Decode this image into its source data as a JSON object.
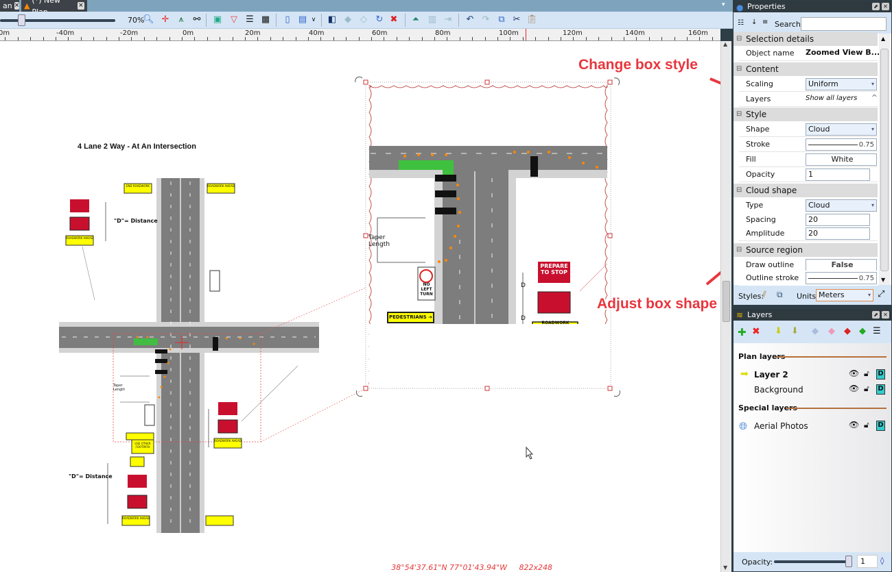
{
  "tabs": [
    {
      "label": "an"
    },
    {
      "label": "(*) New Plan"
    }
  ],
  "toolbar": {
    "zoom": "70%",
    "zoom_fraction": 0.2
  },
  "ruler": {
    "labels": [
      "0m",
      "-40m",
      "-20m",
      "0m",
      "20m",
      "40m",
      "60m",
      "80m",
      "100m",
      "120m",
      "140m",
      "160m"
    ]
  },
  "drawing": {
    "title": "4 Lane 2 Way - At An Intersection",
    "distance_note": "\"D\"= Distance",
    "d": "D",
    "taper": "Taper Length",
    "signs": {
      "end_roadwork": "END ROADWORK",
      "roadwork_ahead": "ROADWORK AHEAD",
      "prepare": "PREPARE TO STOP",
      "no_left": "NO LEFT TURN",
      "pedestrians": "PEDESTRIANS ➔",
      "use_other": "USE OTHER FOOTPATH",
      "roadwork": "ROADWORK"
    }
  },
  "annotations": {
    "change_style": "Change box style",
    "adjust_shape": "Adjust box shape",
    "color": "#e8363d"
  },
  "status": {
    "coords": "38°54'37.61\"N 77°01'43.94\"W",
    "size": "822x248"
  },
  "properties": {
    "title": "Properties",
    "search_label": "Search:",
    "search_value": "",
    "sections": {
      "selection": "Selection details",
      "content": "Content",
      "style": "Style",
      "cloud": "Cloud shape",
      "source": "Source region"
    },
    "object_name_label": "Object name",
    "object_name": "Zoomed View B...",
    "scaling_label": "Scaling",
    "scaling": "Uniform",
    "layers_label": "Layers",
    "layers": "Show all layers",
    "shape_label": "Shape",
    "shape": "Cloud",
    "stroke_label": "Stroke",
    "stroke": "0.75",
    "fill_label": "Fill",
    "fill": "White",
    "opacity_label": "Opacity",
    "opacity": "1",
    "type_label": "Type",
    "type": "Cloud",
    "spacing_label": "Spacing",
    "spacing": "20",
    "amplitude_label": "Amplitude",
    "amplitude": "20",
    "draw_outline_label": "Draw outline",
    "draw_outline": "False",
    "outline_stroke_label": "Outline stroke",
    "outline_stroke": "0.75",
    "styles_label": "Styles:",
    "units_label": "Units:",
    "units": "Meters"
  },
  "layers": {
    "title": "Layers",
    "plan_layers": "Plan layers",
    "special_layers": "Special layers",
    "items": [
      {
        "name": "Layer 2",
        "active": true
      },
      {
        "name": "Background"
      },
      {
        "name": "Aerial Photos"
      }
    ],
    "opacity_label": "Opacity:",
    "opacity": "1",
    "opacity_fraction": 1
  }
}
